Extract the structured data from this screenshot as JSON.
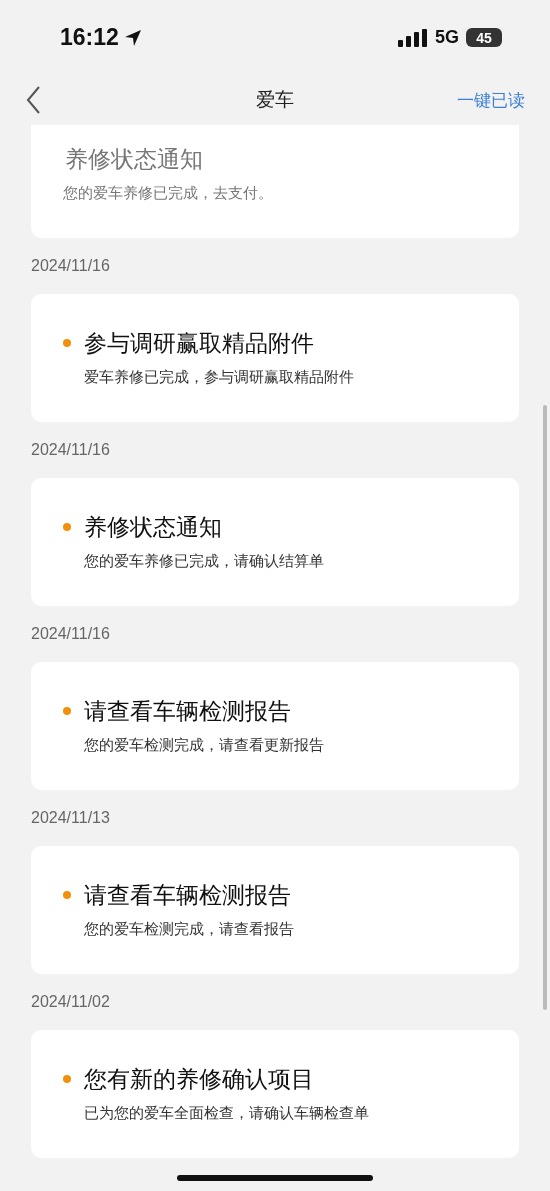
{
  "status_bar": {
    "time": "16:12",
    "network": "5G",
    "battery": "45"
  },
  "nav_bar": {
    "title": "爱车",
    "action": "一键已读"
  },
  "messages": [
    {
      "title": "养修状态通知",
      "body": "您的爱车养修已完成，去支付。",
      "unread": false
    },
    {
      "date": "2024/11/16",
      "title": "参与调研赢取精品附件",
      "body": "爱车养修已完成，参与调研赢取精品附件",
      "unread": true
    },
    {
      "date": "2024/11/16",
      "title": "养修状态通知",
      "body": "您的爱车养修已完成，请确认结算单",
      "unread": true
    },
    {
      "date": "2024/11/16",
      "title": "请查看车辆检测报告",
      "body": "您的爱车检测完成，请查看更新报告",
      "unread": true
    },
    {
      "date": "2024/11/13",
      "title": "请查看车辆检测报告",
      "body": "您的爱车检测完成，请查看报告",
      "unread": true
    },
    {
      "date": "2024/11/02",
      "title": "您有新的养修确认项目",
      "body": "已为您的爱车全面检查，请确认车辆检查单",
      "unread": true
    }
  ]
}
